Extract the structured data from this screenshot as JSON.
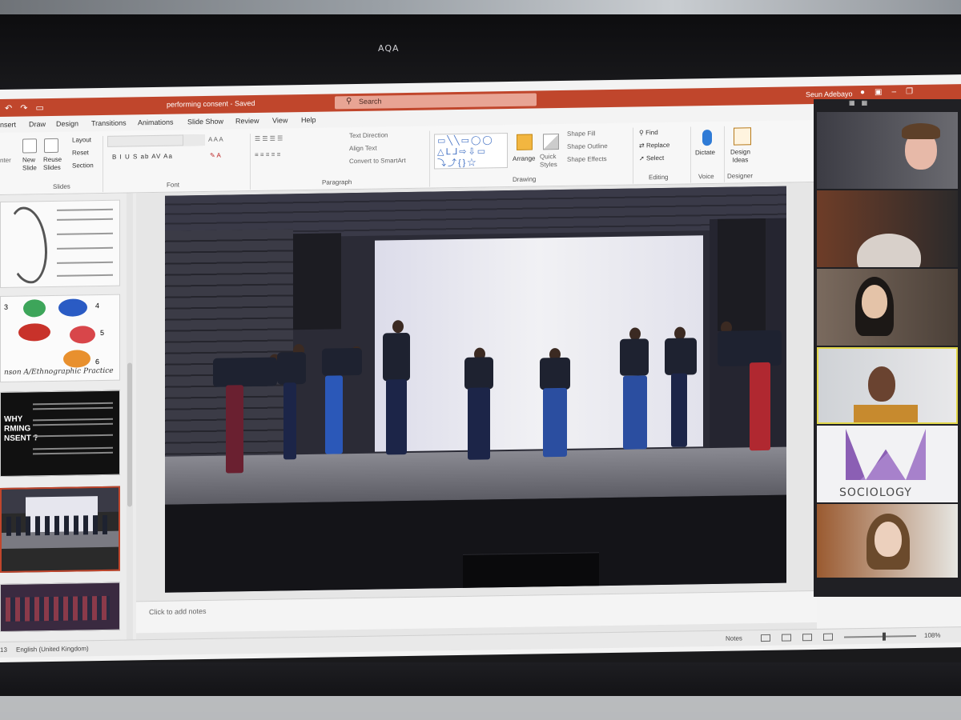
{
  "monitor": {
    "brand": "AQA"
  },
  "titlebar": {
    "doc_title": "performing consent  -  Saved",
    "search_placeholder": "Search",
    "user_name": "Seun Adebayo",
    "qat_icons": [
      "undo-icon",
      "redo-icon",
      "present-icon"
    ]
  },
  "ribbon_tabs": [
    "nsert",
    "Draw",
    "Design",
    "Transitions",
    "Animations",
    "Slide Show",
    "Review",
    "View",
    "Help"
  ],
  "ribbon": {
    "slides": {
      "new_slide": "New\nSlide",
      "reuse_slides": "Reuse\nSlides",
      "layout": "Layout",
      "reset": "Reset",
      "section": "Section",
      "label": "Slides",
      "paste_left": "nter"
    },
    "font": {
      "label": "Font",
      "format_buttons": "B  I  U  S  ab  AV  Aa"
    },
    "paragraph": {
      "label": "Paragraph",
      "text_direction": "Text Direction",
      "align_text": "Align Text",
      "convert_smartart": "Convert to SmartArt"
    },
    "drawing": {
      "label": "Drawing",
      "arrange": "Arrange",
      "quick_styles": "Quick\nStyles",
      "shape_fill": "Shape Fill",
      "shape_outline": "Shape Outline",
      "shape_effects": "Shape Effects"
    },
    "editing": {
      "label": "Editing",
      "find": "Find",
      "replace": "Replace",
      "select": "Select"
    },
    "voice": {
      "label": "Voice",
      "dictate": "Dictate"
    },
    "designer": {
      "label": "Designer",
      "design_ideas": "Design\nIdeas"
    }
  },
  "thumbnails": {
    "slide2_caption": "nson A/Ethnographic Practice",
    "slide3_title": "WHY\nRMING\nNSENT ?",
    "slide2_numbers": [
      "3",
      "4",
      "5",
      "6"
    ]
  },
  "notes": {
    "placeholder": "Click to add notes"
  },
  "statusbar": {
    "slide_number": "13",
    "language": "English (United Kingdom)",
    "notes_label": "Notes",
    "zoom": "108%",
    "zoom_fraction": 0.55
  },
  "video_call": {
    "participants": [
      {
        "type": "person-headset"
      },
      {
        "type": "person-partial"
      },
      {
        "type": "person"
      },
      {
        "type": "person",
        "active": true
      },
      {
        "type": "logo",
        "label": "SOCIOLOGY"
      },
      {
        "type": "person"
      }
    ]
  },
  "colors": {
    "accent": "#c0462c",
    "active_speaker": "#e3d84a",
    "logo_purple": "#8b5fb4"
  }
}
